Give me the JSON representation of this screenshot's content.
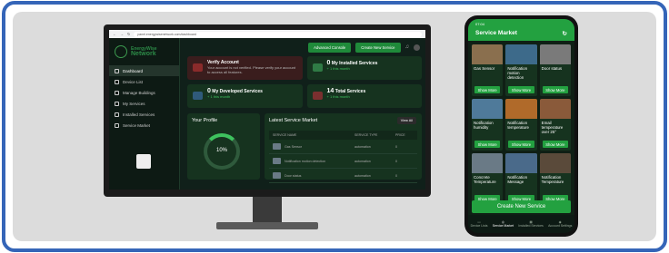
{
  "browser": {
    "url": "panel.energywisenetwork.com/dashboard"
  },
  "sidebar": {
    "brand_top": "EnergyWise",
    "brand_bottom": "Network",
    "items": [
      {
        "label": "Dashboard"
      },
      {
        "label": "Device List"
      },
      {
        "label": "Manage Buildings"
      },
      {
        "label": "My Services"
      },
      {
        "label": "Installed Services"
      },
      {
        "label": "Service Market"
      }
    ]
  },
  "header": {
    "advanced": "Advanced Console",
    "create": "Create New Service"
  },
  "cards": {
    "verify_title": "Verify Account",
    "verify_text": "Your account is not verified. Please verify your account to access all features.",
    "installed_count": "0",
    "installed_label": "My Installed Services",
    "installed_delta": "+ 1 this month",
    "developed_count": "0",
    "developed_label": "My Developed Services",
    "developed_delta": "+ 1 this month",
    "total_count": "14",
    "total_label": "Total Services",
    "total_delta": "+ 1 this month"
  },
  "profile": {
    "title": "Your Profile",
    "percent": "10%"
  },
  "market": {
    "title": "Latest Service Market",
    "view_all": "View All",
    "columns": [
      "SERVICE NAME",
      "SERVICE TYPE",
      "PRICE"
    ],
    "rows": [
      {
        "name": "Gas Sensor",
        "type": "automation",
        "price": "0"
      },
      {
        "name": "Notification motion detection",
        "type": "automation",
        "price": "0"
      },
      {
        "name": "Door status",
        "type": "automation",
        "price": "0"
      }
    ]
  },
  "phone": {
    "status": "07:04",
    "title": "Service Market",
    "show_more": "Show More",
    "tiles": [
      {
        "label": "Gas Sensor",
        "color": "#8a6f4e"
      },
      {
        "label": "Notification motion detection",
        "color": "#3d6a8a"
      },
      {
        "label": "Door status",
        "color": "#7a7a7a"
      },
      {
        "label": "Notification humidity",
        "color": "#4f7a9a"
      },
      {
        "label": "Notification temperature",
        "color": "#b06a2a"
      },
      {
        "label": "Email temperature over 25°",
        "color": "#8a5a3a"
      },
      {
        "label": "Concrete Temperature",
        "color": "#6a7a86"
      },
      {
        "label": "Notification Message",
        "color": "#4a6a8a"
      },
      {
        "label": "Notification Temperature",
        "color": "#5a4a3a"
      }
    ],
    "create": "Create New Service",
    "nav": [
      {
        "label": "Device Lists"
      },
      {
        "label": "Service Market"
      },
      {
        "label": "Installed Services"
      },
      {
        "label": "Account Settings"
      }
    ]
  }
}
